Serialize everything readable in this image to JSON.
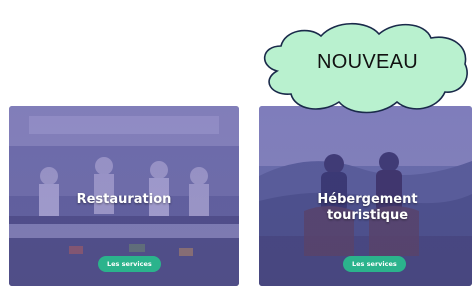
{
  "cards": [
    {
      "title": "Restauration",
      "button_label": "Les services"
    },
    {
      "title_line1": "Hébergement",
      "title_line2": "touristique",
      "button_label": "Les services"
    }
  ],
  "badge": {
    "label": "NOUVEAU"
  },
  "colors": {
    "overlay": "#463ca0",
    "button": "#2bb38c",
    "cloud_fill": "#b9f1cf",
    "cloud_stroke": "#1a2a4a"
  }
}
